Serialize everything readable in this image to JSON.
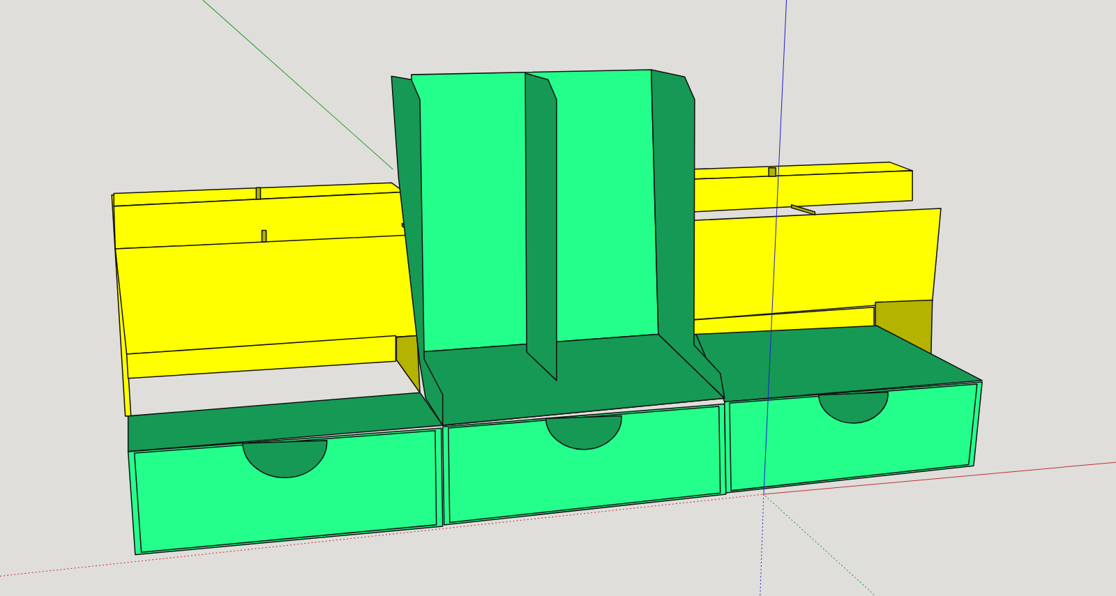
{
  "viewport": {
    "axes": true,
    "parts": [
      {
        "kind": "organizer",
        "color": "#ffff00"
      },
      {
        "kind": "organizer",
        "color": "#ffff00"
      },
      {
        "kind": "drawer-unit",
        "color": "#24ff8c"
      },
      {
        "kind": "drawer-unit",
        "color": "#24ff8c"
      },
      {
        "kind": "drawer-unit",
        "color": "#24ff8c"
      },
      {
        "kind": "file-sorter",
        "color": "#24ff8c"
      }
    ]
  }
}
